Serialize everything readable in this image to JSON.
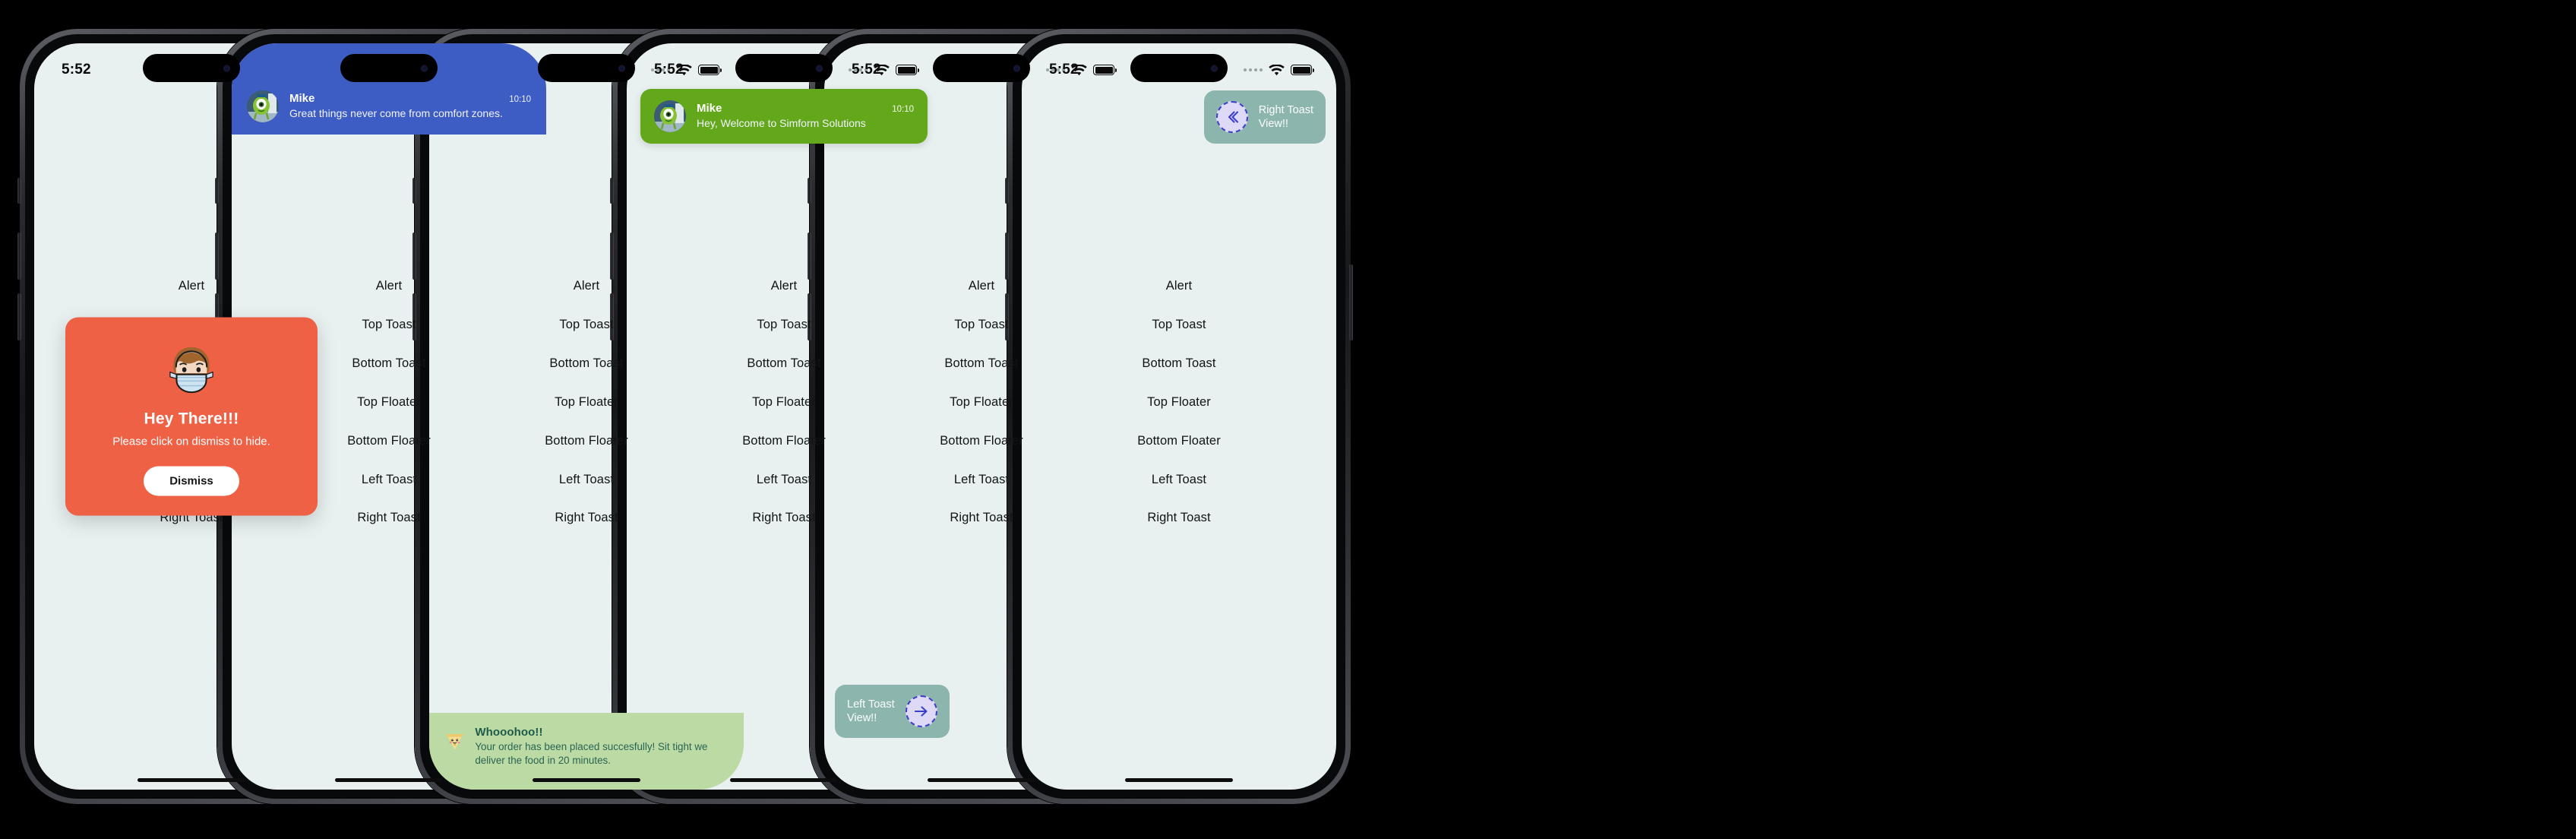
{
  "colors": {
    "screen_bg": "#e8f1f0",
    "blue_toast": "#3d5cc4",
    "green_floater": "#62a81a",
    "green_bottom_toast": "#bcdba4",
    "green_toast_text": "#2a6354",
    "teal_side_toast": "#8cb5ae",
    "alert_card": "#ef6144",
    "device_body": "#17181b"
  },
  "status_bar": {
    "time": "5:52",
    "signal_icon": "signal-dots-icon",
    "wifi_icon": "wifi-icon",
    "battery_icon": "battery-full-icon"
  },
  "menu": {
    "items": [
      {
        "label": "Alert"
      },
      {
        "label": "Top Toast"
      },
      {
        "label": "Bottom Toast"
      },
      {
        "label": "Top Floater"
      },
      {
        "label": "Bottom Floater"
      },
      {
        "label": "Left Toast"
      },
      {
        "label": "Right Toast"
      }
    ]
  },
  "phones": [
    {
      "id": "phone-alert",
      "demo": "Alert",
      "alert": {
        "icon": "masked-face-icon",
        "title": "Hey There!!!",
        "subtitle": "Please click on dismiss to hide.",
        "button_label": "Dismiss"
      }
    },
    {
      "id": "phone-top-toast",
      "demo": "Top Toast",
      "toast": {
        "avatar_icon": "mike-avatar-icon",
        "name": "Mike",
        "time": "10:10",
        "message": "Great things never come from comfort zones."
      }
    },
    {
      "id": "phone-bottom-toast",
      "demo": "Bottom Toast",
      "toast": {
        "icon": "pizza-slice-icon",
        "title": "Whooohoo!!",
        "message": "Your order has been placed succesfully! Sit tight we deliver the food in 20 minutes."
      }
    },
    {
      "id": "phone-top-floater",
      "demo": "Top Floater",
      "toast": {
        "avatar_icon": "mike-avatar-icon",
        "name": "Mike",
        "time": "10:10",
        "message": "Hey, Welcome to Simform Solutions"
      }
    },
    {
      "id": "phone-left-toast",
      "demo": "Left Toast",
      "toast": {
        "label": "Left Toast\nView!!",
        "icon": "arrow-right-circle-icon"
      }
    },
    {
      "id": "phone-right-toast",
      "demo": "Right Toast",
      "toast": {
        "label": "Right Toast\nView!!",
        "icon": "chevron-left-circle-icon"
      }
    }
  ]
}
